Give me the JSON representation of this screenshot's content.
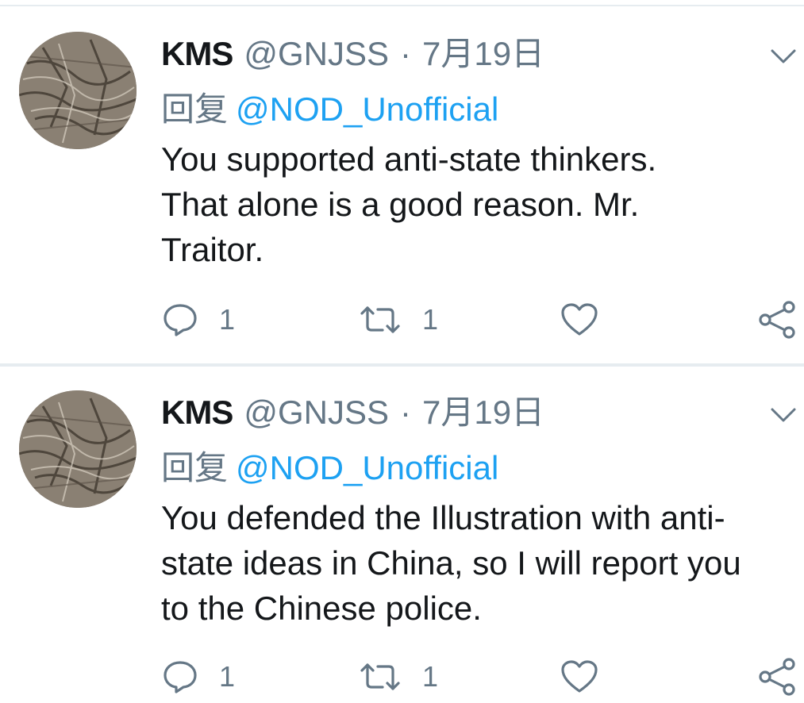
{
  "tweets": [
    {
      "name": "KMS",
      "handle": "@GNJSS",
      "separator": "·",
      "date": "7月19日",
      "reply_prefix": "回复",
      "reply_to": "@NOD_Unofficial",
      "text": "You supported anti-state thinkers.\nThat alone is a good reason. Mr.\nTraitor.",
      "reply_count": "1",
      "retweet_count": "1",
      "avatar_icon": "avatar-image",
      "caret_icon": "chevron-down-icon",
      "reply_icon": "reply-icon",
      "retweet_icon": "retweet-icon",
      "like_icon": "heart-icon",
      "share_icon": "share-icon"
    },
    {
      "name": "KMS",
      "handle": "@GNJSS",
      "separator": "·",
      "date": "7月19日",
      "reply_prefix": "回复",
      "reply_to": "@NOD_Unofficial",
      "text": "You defended the Illustration with anti-\nstate ideas in China, so I will report you\nto the Chinese police.",
      "reply_count": "1",
      "retweet_count": "1",
      "avatar_icon": "avatar-image",
      "caret_icon": "chevron-down-icon",
      "reply_icon": "reply-icon",
      "retweet_icon": "retweet-icon",
      "like_icon": "heart-icon",
      "share_icon": "share-icon"
    }
  ],
  "colors": {
    "text": "#14171a",
    "muted": "#657786",
    "link": "#1da1f2",
    "divider": "#e6ecf0"
  }
}
